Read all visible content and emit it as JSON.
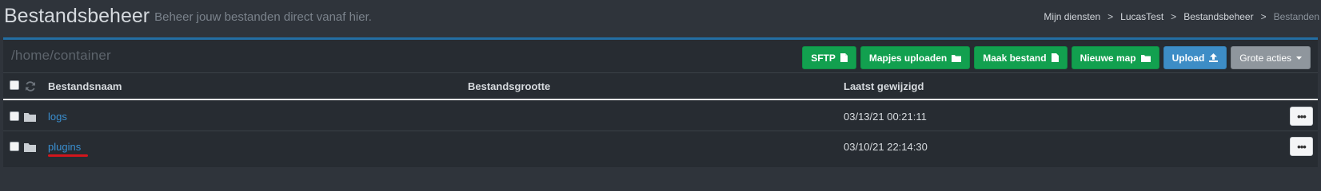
{
  "header": {
    "title": "Bestandsbeheer",
    "subtitle": "Beheer jouw bestanden direct vanaf hier.",
    "breadcrumb": [
      "Mijn diensten",
      "LucasTest",
      "Bestandsbeheer",
      "Bestanden"
    ],
    "breadcrumb_separator": ">"
  },
  "path": "/home/container",
  "actions": {
    "sftp": "SFTP",
    "upload_folders": "Mapjes uploaden",
    "create_file": "Maak bestand",
    "new_folder": "Nieuwe map",
    "upload": "Upload",
    "bulk_actions": "Grote acties"
  },
  "table": {
    "columns": [
      "Bestandsnaam",
      "Bestandsgrootte",
      "Laatst gewijzigd"
    ],
    "rows": [
      {
        "name": "logs",
        "size": "",
        "modified": "03/13/21 00:21:11"
      },
      {
        "name": "plugins",
        "size": "",
        "modified": "03/10/21 22:14:30"
      }
    ],
    "row_menu": "•••"
  },
  "colors": {
    "background": "#2f343b",
    "panel": "#272c32",
    "accent_border": "#236ea3",
    "green": "#12a04f",
    "blue": "#3d8dc6",
    "grey": "#8f969d",
    "link": "#3a8fd0",
    "highlight_underline": "#d2161c"
  },
  "icons": {
    "sftp": "file-icon",
    "upload_folders": "folder-icon",
    "create_file": "file-icon",
    "new_folder": "folder-icon",
    "upload": "upload-icon",
    "bulk_actions": "caret-down-icon",
    "header_refresh": "refresh-icon",
    "row": "folder-icon"
  }
}
